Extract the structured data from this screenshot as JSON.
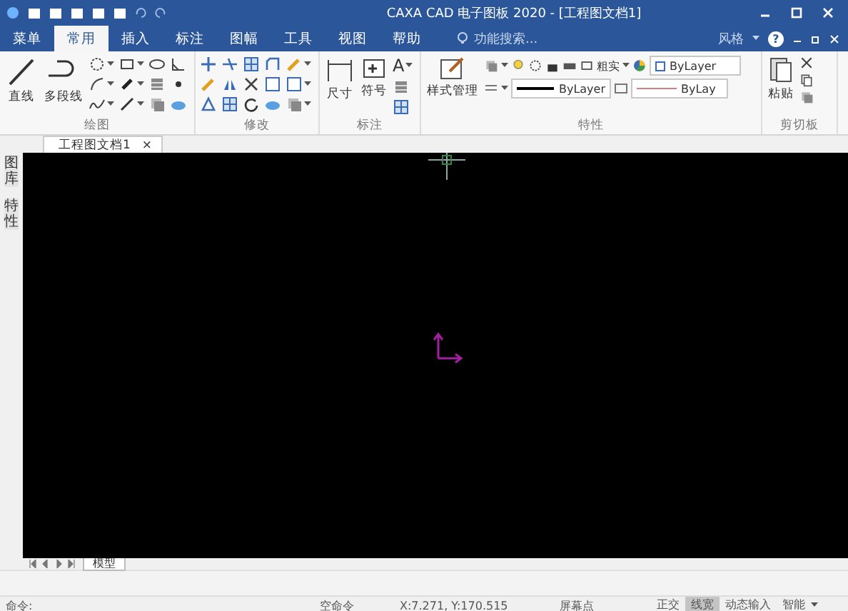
{
  "title_bar": {
    "title": "CAXA CAD 电子图板 2020 - [工程图文档1]"
  },
  "menu_tabs": [
    {
      "label": "菜单",
      "selected": false
    },
    {
      "label": "常用",
      "selected": true
    },
    {
      "label": "插入",
      "selected": false
    },
    {
      "label": "标注",
      "selected": false
    },
    {
      "label": "图幅",
      "selected": false
    },
    {
      "label": "工具",
      "selected": false
    },
    {
      "label": "视图",
      "selected": false
    },
    {
      "label": "帮助",
      "selected": false
    }
  ],
  "search": {
    "placeholder": "功能搜索..."
  },
  "style_menu": {
    "label": "风格",
    "help": "?"
  },
  "ribbon": {
    "draw": {
      "label": "绘图",
      "tools": [
        "直线",
        "多段线"
      ]
    },
    "modify": {
      "label": "修改"
    },
    "annotate": {
      "label": "标注",
      "tools": [
        "尺寸",
        "符号"
      ],
      "text_tool": "A"
    },
    "properties": {
      "label": "特性",
      "style_button": "样式管理",
      "layer": "粗实",
      "color_setting": "ByLayer",
      "linetype": "ByLayer",
      "linewidth": "ByLay"
    },
    "clipboard": {
      "label": "剪切板",
      "paste": "粘贴"
    }
  },
  "side_panel": [
    {
      "label": "图库"
    },
    {
      "label": "特性"
    }
  ],
  "doc_tabs": [
    {
      "label": "工程图文档1",
      "selected": true,
      "close": "×"
    }
  ],
  "model_tabs": [
    {
      "label": "模型",
      "selected": true
    }
  ],
  "status_bar": {
    "prompt": "命令:",
    "command": "空命令",
    "coordinates": "X:7.271, Y:170.515",
    "snap": "屏幕点",
    "toggles": [
      {
        "label": "正交",
        "on": false
      },
      {
        "label": "线宽",
        "on": true
      },
      {
        "label": "动态输入",
        "on": false
      },
      {
        "label": "智能",
        "on": false
      }
    ]
  }
}
